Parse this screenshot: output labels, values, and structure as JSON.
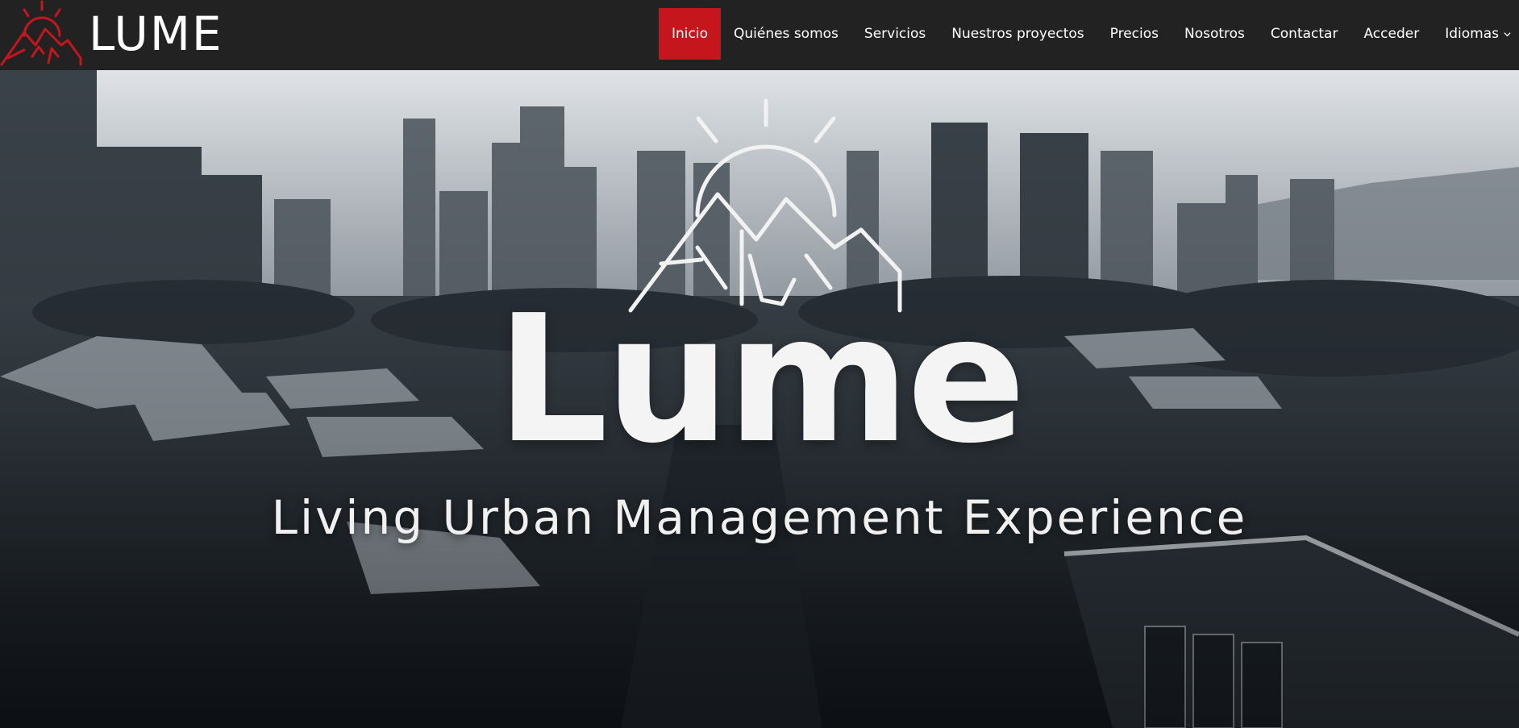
{
  "brand": {
    "name": "LUME",
    "logo_icon": "sun-mountain-logo-icon",
    "logo_color": "#c4161c"
  },
  "nav": {
    "items": [
      {
        "label": "Inicio",
        "active": true
      },
      {
        "label": "Quiénes somos"
      },
      {
        "label": "Servicios"
      },
      {
        "label": "Nuestros proyectos"
      },
      {
        "label": "Precios"
      },
      {
        "label": "Nosotros"
      },
      {
        "label": "Contactar"
      },
      {
        "label": "Acceder"
      },
      {
        "label": "Idiomas",
        "icon": "chevron-down-icon"
      }
    ],
    "active_color": "#c4161c",
    "background": "#222222"
  },
  "hero": {
    "title": "Lume",
    "subtitle": "Living Urban Management Experience",
    "logo_icon": "sun-mountain-logo-icon",
    "background_image": "city-skyline-and-neighborhood-image"
  }
}
